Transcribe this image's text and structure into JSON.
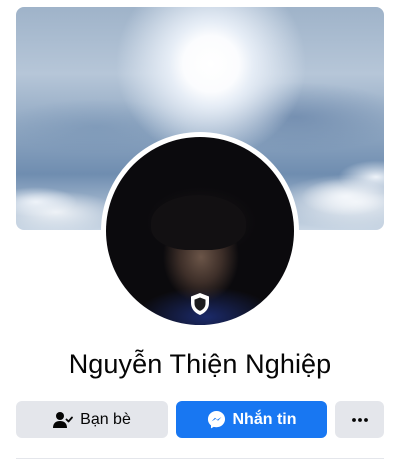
{
  "profile": {
    "name": "Nguyễn Thiện Nghiệp"
  },
  "actions": {
    "friends_label": "Bạn bè",
    "message_label": "Nhắn tin",
    "more_icon": "more-horizontal-icon"
  },
  "icons": {
    "friends": "person-check-icon",
    "message": "messenger-icon",
    "shield": "profile-guard-shield-icon"
  },
  "colors": {
    "primary": "#1877f2",
    "secondary_button": "#e4e6eb",
    "text": "#050505"
  }
}
